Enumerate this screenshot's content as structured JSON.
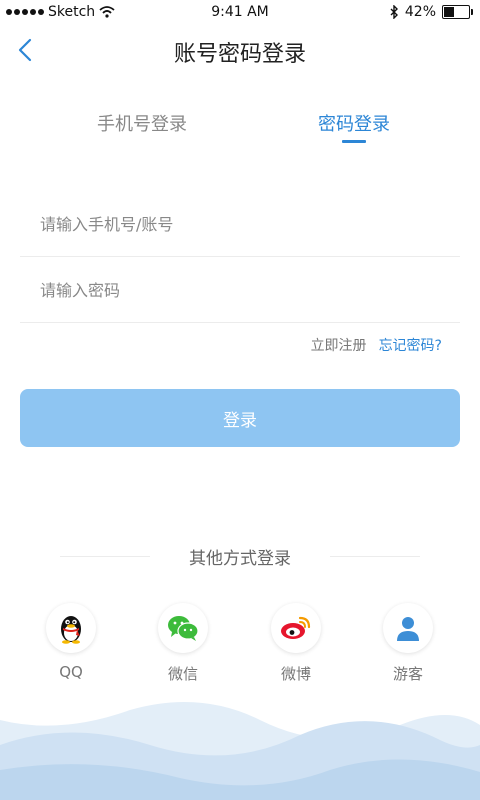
{
  "status_bar": {
    "carrier": "Sketch",
    "time": "9:41 AM",
    "battery_percent": "42%",
    "battery_level": 0.42
  },
  "nav": {
    "title": "账号密码登录",
    "back_icon": "chevron-left-icon"
  },
  "tabs": [
    {
      "label": "手机号登录",
      "active": false
    },
    {
      "label": "密码登录",
      "active": true
    }
  ],
  "form": {
    "account_placeholder": "请输入手机号/账号",
    "account_value": "",
    "password_placeholder": "请输入密码",
    "password_value": ""
  },
  "links": {
    "register": "立即注册",
    "forgot": "忘记密码?"
  },
  "login_button": "登录",
  "other_login": {
    "title": "其他方式登录",
    "items": [
      {
        "label": "QQ",
        "icon": "qq-penguin-icon"
      },
      {
        "label": "微信",
        "icon": "wechat-icon"
      },
      {
        "label": "微博",
        "icon": "weibo-icon"
      },
      {
        "label": "游客",
        "icon": "guest-user-icon"
      }
    ]
  },
  "colors": {
    "accent": "#2c86d6",
    "button": "#8ec5f2",
    "wechat": "#3dbb3b",
    "weibo": "#e6162d",
    "guest": "#3d8ed6"
  }
}
